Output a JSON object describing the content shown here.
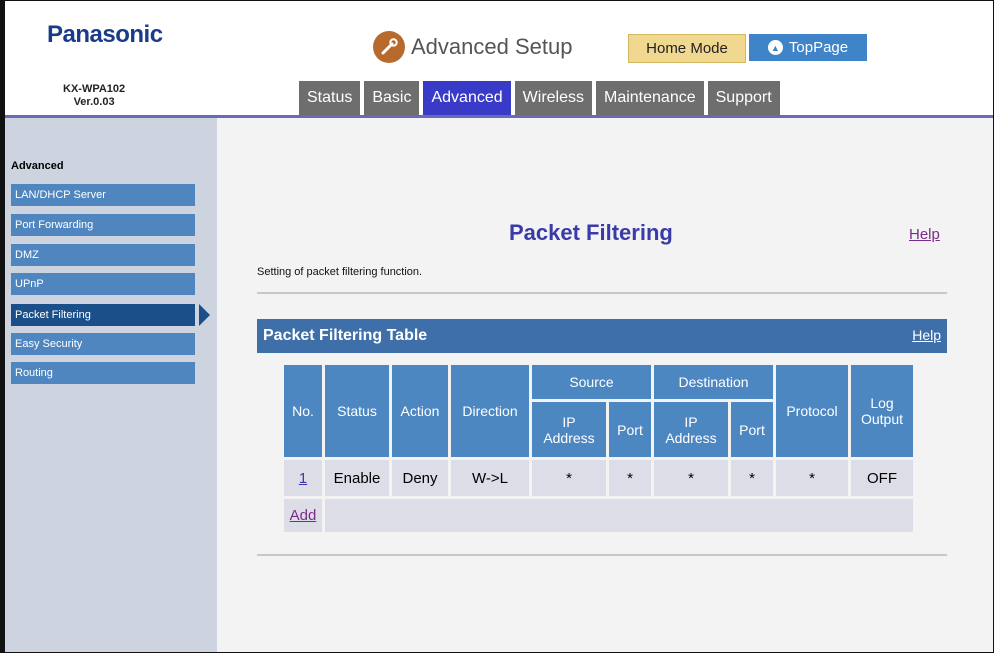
{
  "brand": "Panasonic",
  "model": {
    "name": "KX-WPA102",
    "version": "Ver.0.03"
  },
  "header": {
    "title": "Advanced Setup",
    "home_mode": "Home Mode",
    "toppage": "TopPage"
  },
  "tabs": [
    {
      "label": "Status"
    },
    {
      "label": "Basic"
    },
    {
      "label": "Advanced",
      "active": true
    },
    {
      "label": "Wireless"
    },
    {
      "label": "Maintenance"
    },
    {
      "label": "Support"
    }
  ],
  "sidebar": {
    "heading": "Advanced",
    "items": [
      {
        "label": "LAN/DHCP Server"
      },
      {
        "label": "Port Forwarding"
      },
      {
        "label": "DMZ"
      },
      {
        "label": "UPnP"
      },
      {
        "label": "Packet Filtering",
        "active": true
      },
      {
        "label": "Easy Security"
      },
      {
        "label": "Routing"
      }
    ]
  },
  "main": {
    "title": "Packet Filtering",
    "help": "Help",
    "description": "Setting of packet filtering function.",
    "table_title": "Packet Filtering Table",
    "table_help": "Help",
    "columns": {
      "no": "No.",
      "status": "Status",
      "action": "Action",
      "direction": "Direction",
      "source": "Source",
      "destination": "Destination",
      "ip1": "IP",
      "ip2": "Address",
      "port": "Port",
      "protocol": "Protocol",
      "log1": "Log",
      "log2": "Output"
    },
    "rows": [
      {
        "no": "1",
        "status": "Enable",
        "action": "Deny",
        "direction": "W->L",
        "src_ip": "*",
        "src_port": "*",
        "dst_ip": "*",
        "dst_port": "*",
        "protocol": "*",
        "log": "OFF"
      }
    ],
    "add": "Add"
  },
  "colors": {
    "tab": "#6e6e6e",
    "tab_active": "#3a3ac8",
    "sidebar_item": "#4f86c0",
    "table_header": "#4d87c2",
    "title": "#3a3aa8"
  }
}
